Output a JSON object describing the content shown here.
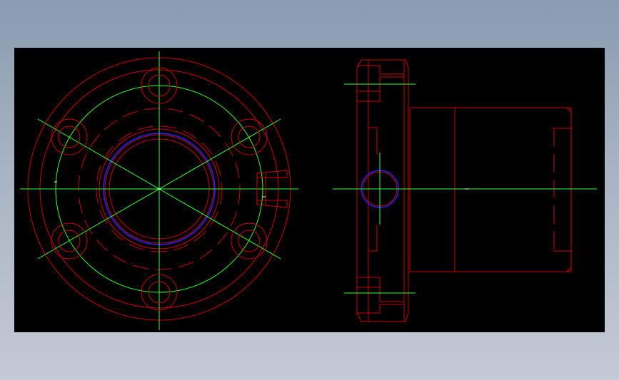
{
  "drawing": {
    "background_color": "#000000",
    "outline_color": "#cc0000",
    "centerline_color": "#33ff33",
    "thread_color": "#2222ff",
    "marker_color": "#ffffff",
    "views": [
      "front-view",
      "side-view"
    ],
    "bolt_hole_count": 6
  }
}
